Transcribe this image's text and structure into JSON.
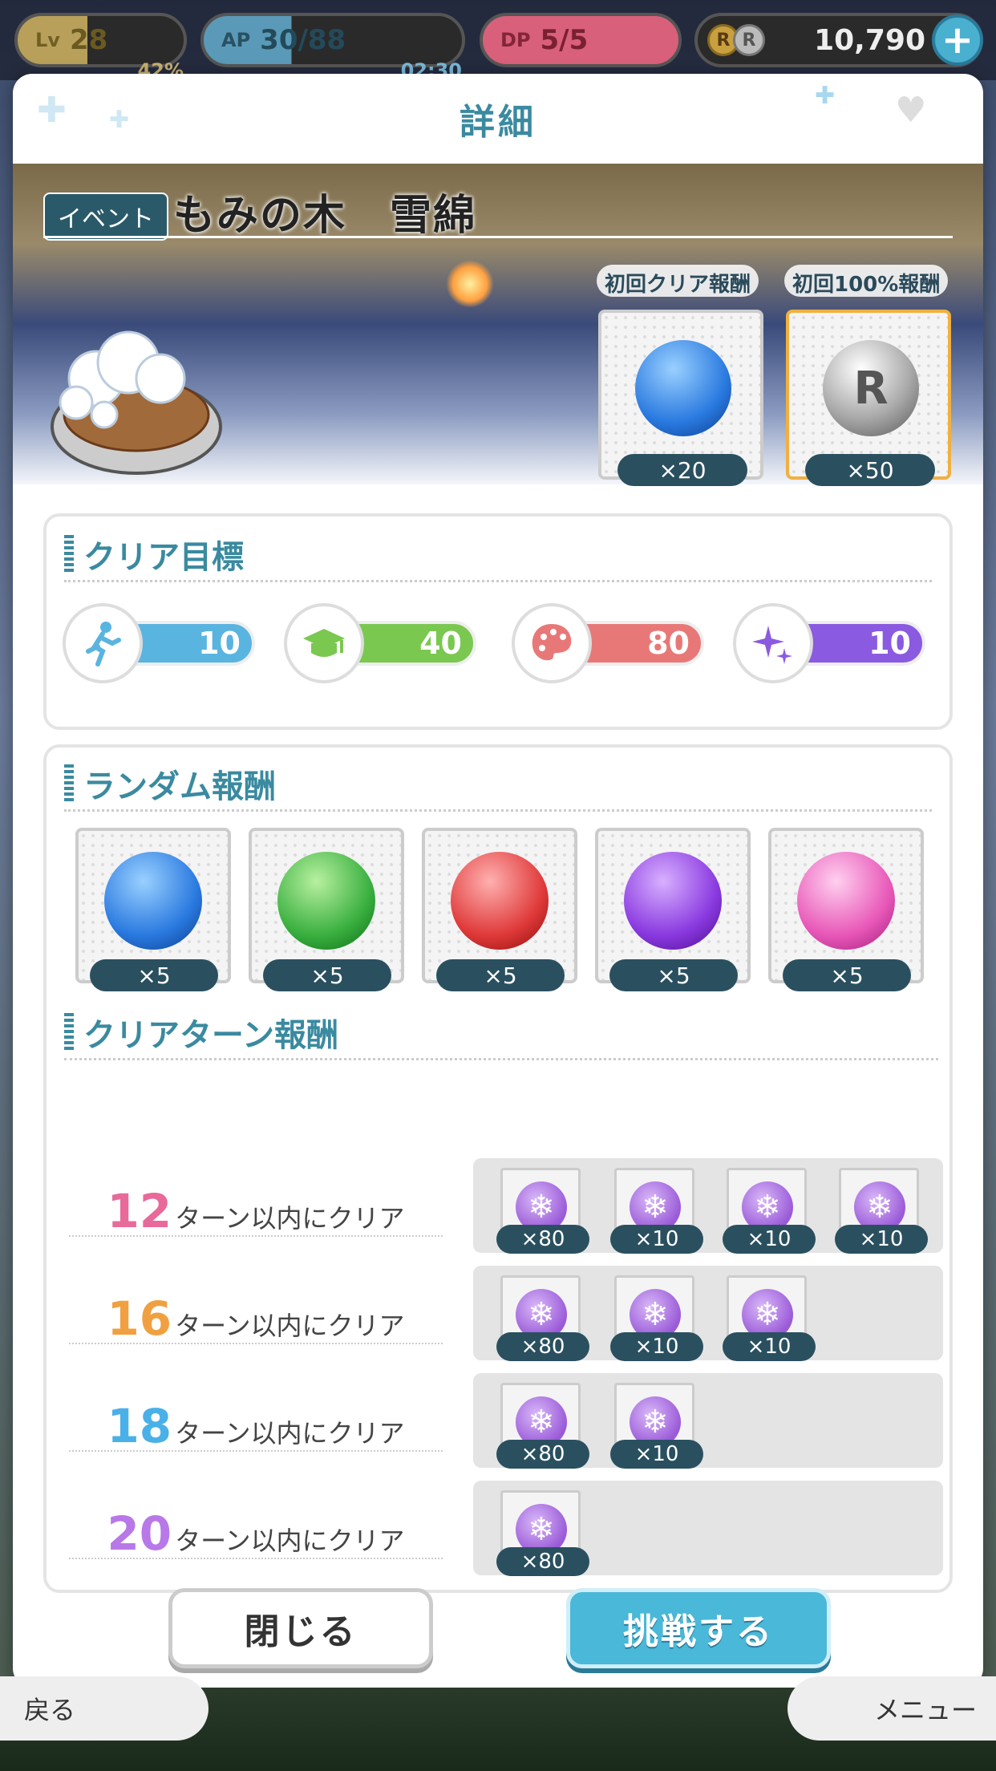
{
  "status": {
    "level": {
      "tag": "Lv",
      "value": "28",
      "sub": "42%"
    },
    "ap": {
      "tag": "AP",
      "value": "30/88",
      "sub": "02:30"
    },
    "dp": {
      "tag": "DP",
      "value": "5/5"
    },
    "coins": {
      "value": "10,790",
      "coin1": "R",
      "coin2": "R"
    }
  },
  "modal": {
    "title": "詳細",
    "event_tag": "イベント",
    "stage_name": "もみの木　雪綿",
    "first_clear_label": "初回クリア報酬",
    "first_clear_count": "×20",
    "first_clear_orb_color": "#2a7ae0",
    "first100_label": "初回100%報酬",
    "first100_count": "×50",
    "first100_icon": "R"
  },
  "clear_goals": {
    "heading": "クリア目標",
    "items": [
      {
        "icon": "running-icon",
        "value": "10",
        "color": "#5ab4e0"
      },
      {
        "icon": "graduation-cap-icon",
        "value": "40",
        "color": "#7ac850"
      },
      {
        "icon": "palette-icon",
        "value": "80",
        "color": "#e87878"
      },
      {
        "icon": "sparkle-icon",
        "value": "10",
        "color": "#8a5ae0"
      }
    ]
  },
  "random_rewards": {
    "heading": "ランダム報酬",
    "items": [
      {
        "count": "×5",
        "color": "#2a7ae0"
      },
      {
        "count": "×5",
        "color": "#3ab040"
      },
      {
        "count": "×5",
        "color": "#e03a3a"
      },
      {
        "count": "×5",
        "color": "#8a3ae0"
      },
      {
        "count": "×5",
        "color": "#e858b8"
      }
    ]
  },
  "turn_rewards": {
    "heading": "クリアターン報酬",
    "rows": [
      {
        "turns": "12",
        "text": "ターン以内にクリア",
        "color": "#e86a9a",
        "rewards": [
          "×80",
          "×10",
          "×10",
          "×10"
        ]
      },
      {
        "turns": "16",
        "text": "ターン以内にクリア",
        "color": "#f0a040",
        "rewards": [
          "×80",
          "×10",
          "×10"
        ]
      },
      {
        "turns": "18",
        "text": "ターン以内にクリア",
        "color": "#4ab0e8",
        "rewards": [
          "×80",
          "×10"
        ]
      },
      {
        "turns": "20",
        "text": "ターン以内にクリア",
        "color": "#b878e8",
        "rewards": [
          "×80"
        ]
      }
    ]
  },
  "buttons": {
    "close": "閉じる",
    "challenge": "挑戦する"
  },
  "nav": {
    "back": "戻る",
    "menu": "メニュー"
  }
}
